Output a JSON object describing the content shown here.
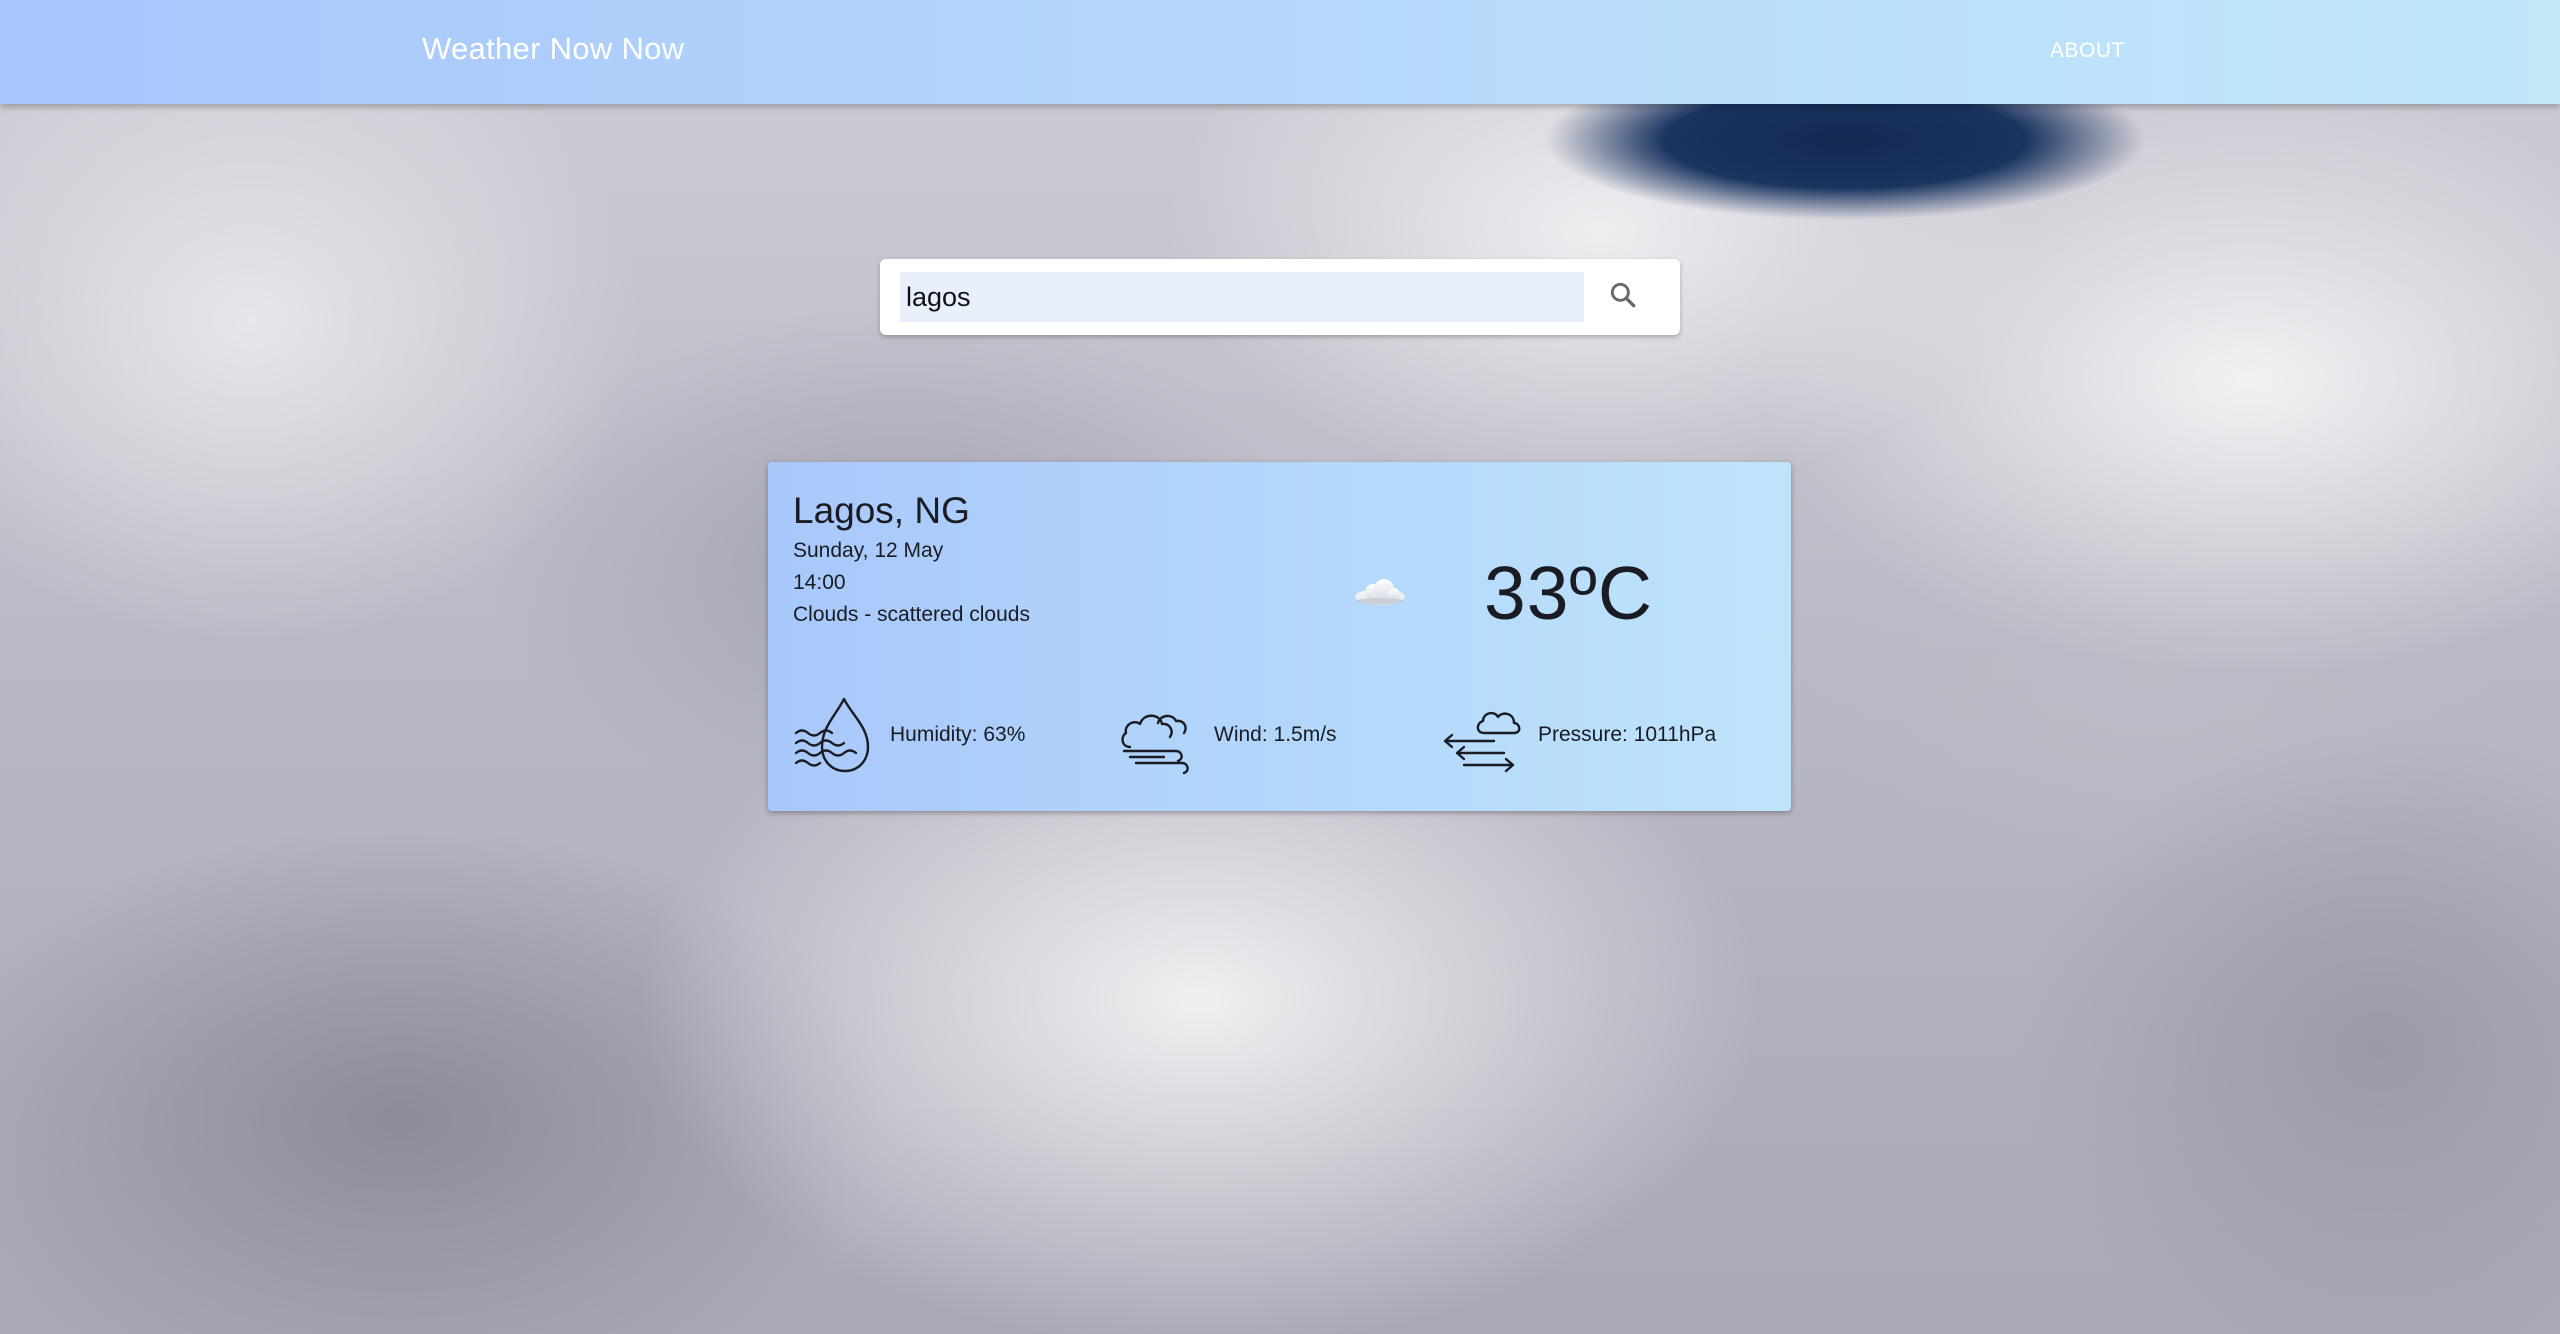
{
  "app": {
    "brand": "Weather Now Now",
    "nav_about": "ABOUT"
  },
  "search": {
    "value": "lagos",
    "icon": "search-icon"
  },
  "weather": {
    "location": "Lagos, NG",
    "date": "Sunday, 12 May",
    "time": "14:00",
    "description": "Clouds - scattered clouds",
    "condition_icon": "cloud-icon",
    "temperature": "33ºC",
    "stats": {
      "humidity": {
        "label": "Humidity: 63%",
        "icon": "humidity-drop-icon"
      },
      "wind": {
        "label": "Wind: 1.5m/s",
        "icon": "wind-cloud-icon"
      },
      "pressure": {
        "label": "Pressure: 1011hPa",
        "icon": "pressure-arrows-icon"
      }
    }
  },
  "colors": {
    "appbar_start": "#a7c6fb",
    "appbar_end": "#c1e7f9",
    "card_start": "#a8c8fb",
    "card_end": "#bfe4fa",
    "text": "#1b1b24"
  }
}
